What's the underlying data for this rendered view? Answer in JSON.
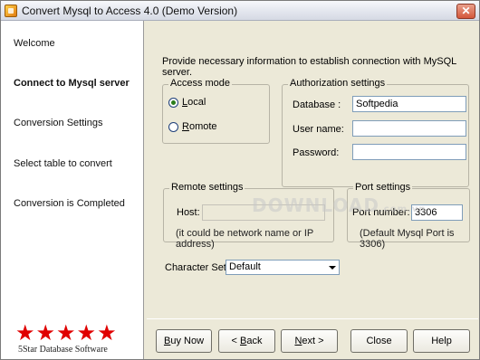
{
  "window": {
    "title": "Convert Mysql to Access 4.0 (Demo Version)",
    "close_glyph": "✕"
  },
  "sidebar": {
    "items": [
      {
        "label": "Welcome",
        "active": false
      },
      {
        "label": "Connect to Mysql server",
        "active": true
      },
      {
        "label": "Conversion Settings",
        "active": false
      },
      {
        "label": "Select table to convert",
        "active": false
      },
      {
        "label": "Conversion is Completed",
        "active": false
      }
    ],
    "logo": {
      "stars": "★★★★★",
      "text": "5Star Database Software"
    }
  },
  "main": {
    "intro": "Provide necessary information to establish connection with MySQL server.",
    "access_mode": {
      "legend": "Access mode",
      "local": {
        "label_rest": "ocal",
        "mnemonic": "L",
        "checked": true
      },
      "remote": {
        "label_rest": "omote",
        "mnemonic": "R",
        "checked": false
      }
    },
    "authorization": {
      "legend": "Authorization settings",
      "database_label": "Database :",
      "database_value": "Softpedia",
      "username_label": "User name:",
      "username_value": "",
      "password_label": "Password:",
      "password_value": ""
    },
    "remote_settings": {
      "legend": "Remote settings",
      "host_label": "Host:",
      "host_value": "",
      "hint": "(it could be network name or IP address)"
    },
    "port_settings": {
      "legend": "Port settings",
      "port_label": "Port number:",
      "port_value": "3306",
      "hint": "(Default Mysql Port is 3306)"
    },
    "charset": {
      "label": "Character Set",
      "value": "Default"
    },
    "watermark": {
      "text": "DOWNLOAD",
      "suffix": ".com.vn"
    }
  },
  "buttons": {
    "buy_now": {
      "mnemonic": "B",
      "rest": "uy Now"
    },
    "back": {
      "prefix": "< ",
      "mnemonic": "B",
      "rest": "ack"
    },
    "next": {
      "mnemonic": "N",
      "rest": "ext >"
    },
    "close": "Close",
    "help": "Help"
  },
  "colors": {
    "accent_red": "#e00000",
    "radio_dot": "#2a7d1a",
    "input_border": "#7f9db9"
  }
}
